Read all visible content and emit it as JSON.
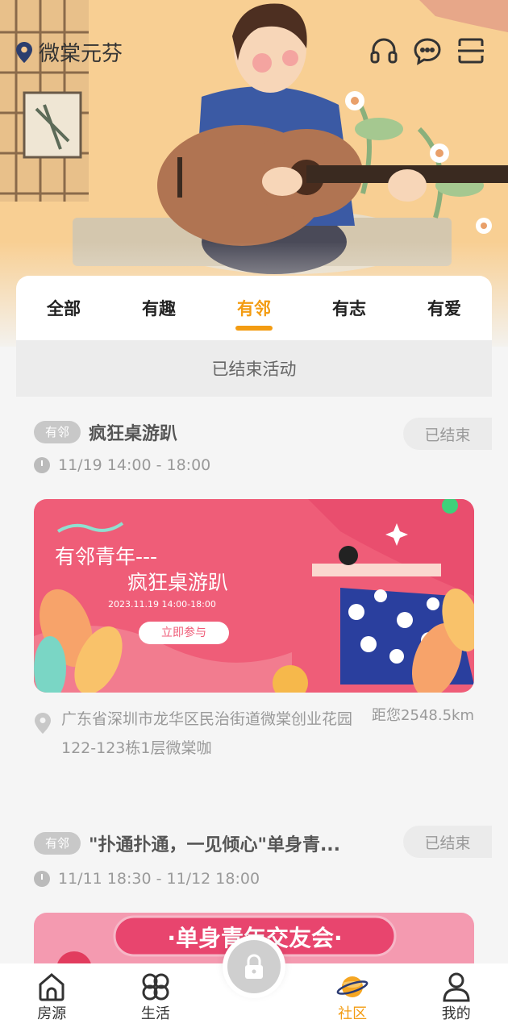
{
  "header": {
    "location": "微棠元芬",
    "icons": [
      "headset-icon",
      "chat-icon",
      "scan-icon"
    ]
  },
  "tabs": [
    {
      "label": "全部",
      "active": false
    },
    {
      "label": "有趣",
      "active": false
    },
    {
      "label": "有邻",
      "active": true
    },
    {
      "label": "有志",
      "active": false
    },
    {
      "label": "有爱",
      "active": false
    }
  ],
  "section_title": "已结束活动",
  "events": [
    {
      "tag": "有邻",
      "title": "疯狂桌游趴",
      "status": "已结束",
      "time": "11/19 14:00 - 18:00",
      "banner": {
        "line1": "有邻青年---",
        "line2": "疯狂桌游趴",
        "date": "2023.11.19 14:00-18:00",
        "button": "立即参与"
      },
      "address": "广东省深圳市龙华区民治街道微棠创业花园122-123栋1层微棠咖",
      "distance": "距您2548.5km"
    },
    {
      "tag": "有邻",
      "title": "\"扑通扑通，一见倾心\"单身青...",
      "status": "已结束",
      "time": "11/11 18:30 - 11/12 18:00",
      "banner": {
        "line1": "·单身青年交友会·"
      }
    }
  ],
  "bottom_nav": [
    {
      "label": "房源",
      "icon": "home-icon",
      "active": false
    },
    {
      "label": "生活",
      "icon": "clover-icon",
      "active": false
    },
    {
      "label": "社区",
      "icon": "planet-icon",
      "active": true
    },
    {
      "label": "我的",
      "icon": "user-icon",
      "active": false
    }
  ],
  "colors": {
    "accent": "#f39c12",
    "banner_pink": "#ee5a78"
  }
}
